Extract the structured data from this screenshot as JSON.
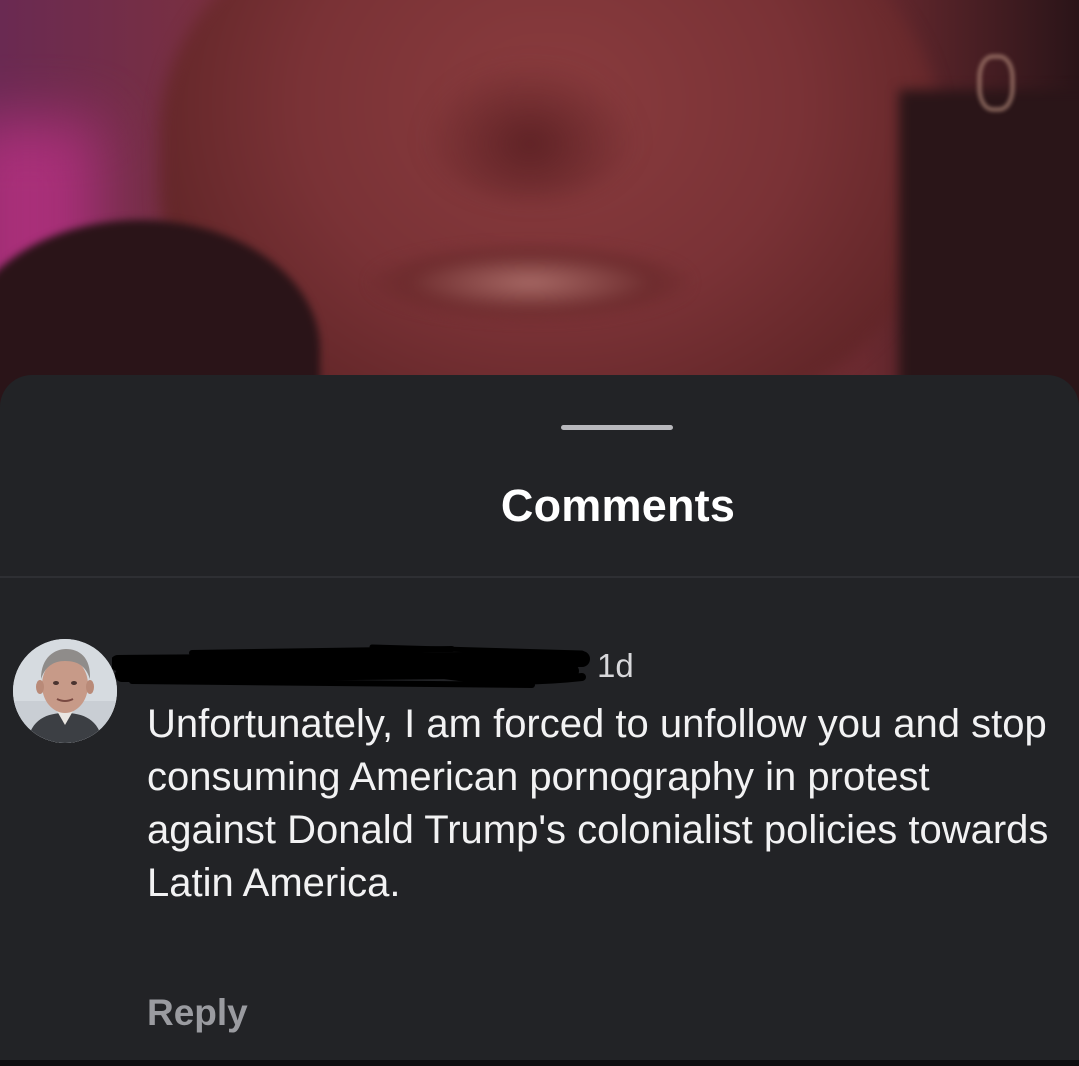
{
  "sheet": {
    "title": "Comments"
  },
  "comment": {
    "timestamp": "1d",
    "text": "Unfortunately, I am forced to unfollow you and stop consuming American pornography in protest against Donald Trump's colonialist policies towards Latin America.",
    "reply_label": "Reply"
  },
  "colors": {
    "sheet_background": "#222326",
    "title_text": "#ffffff",
    "body_text": "#f2f2f3",
    "secondary_text": "#9a9ba0"
  }
}
